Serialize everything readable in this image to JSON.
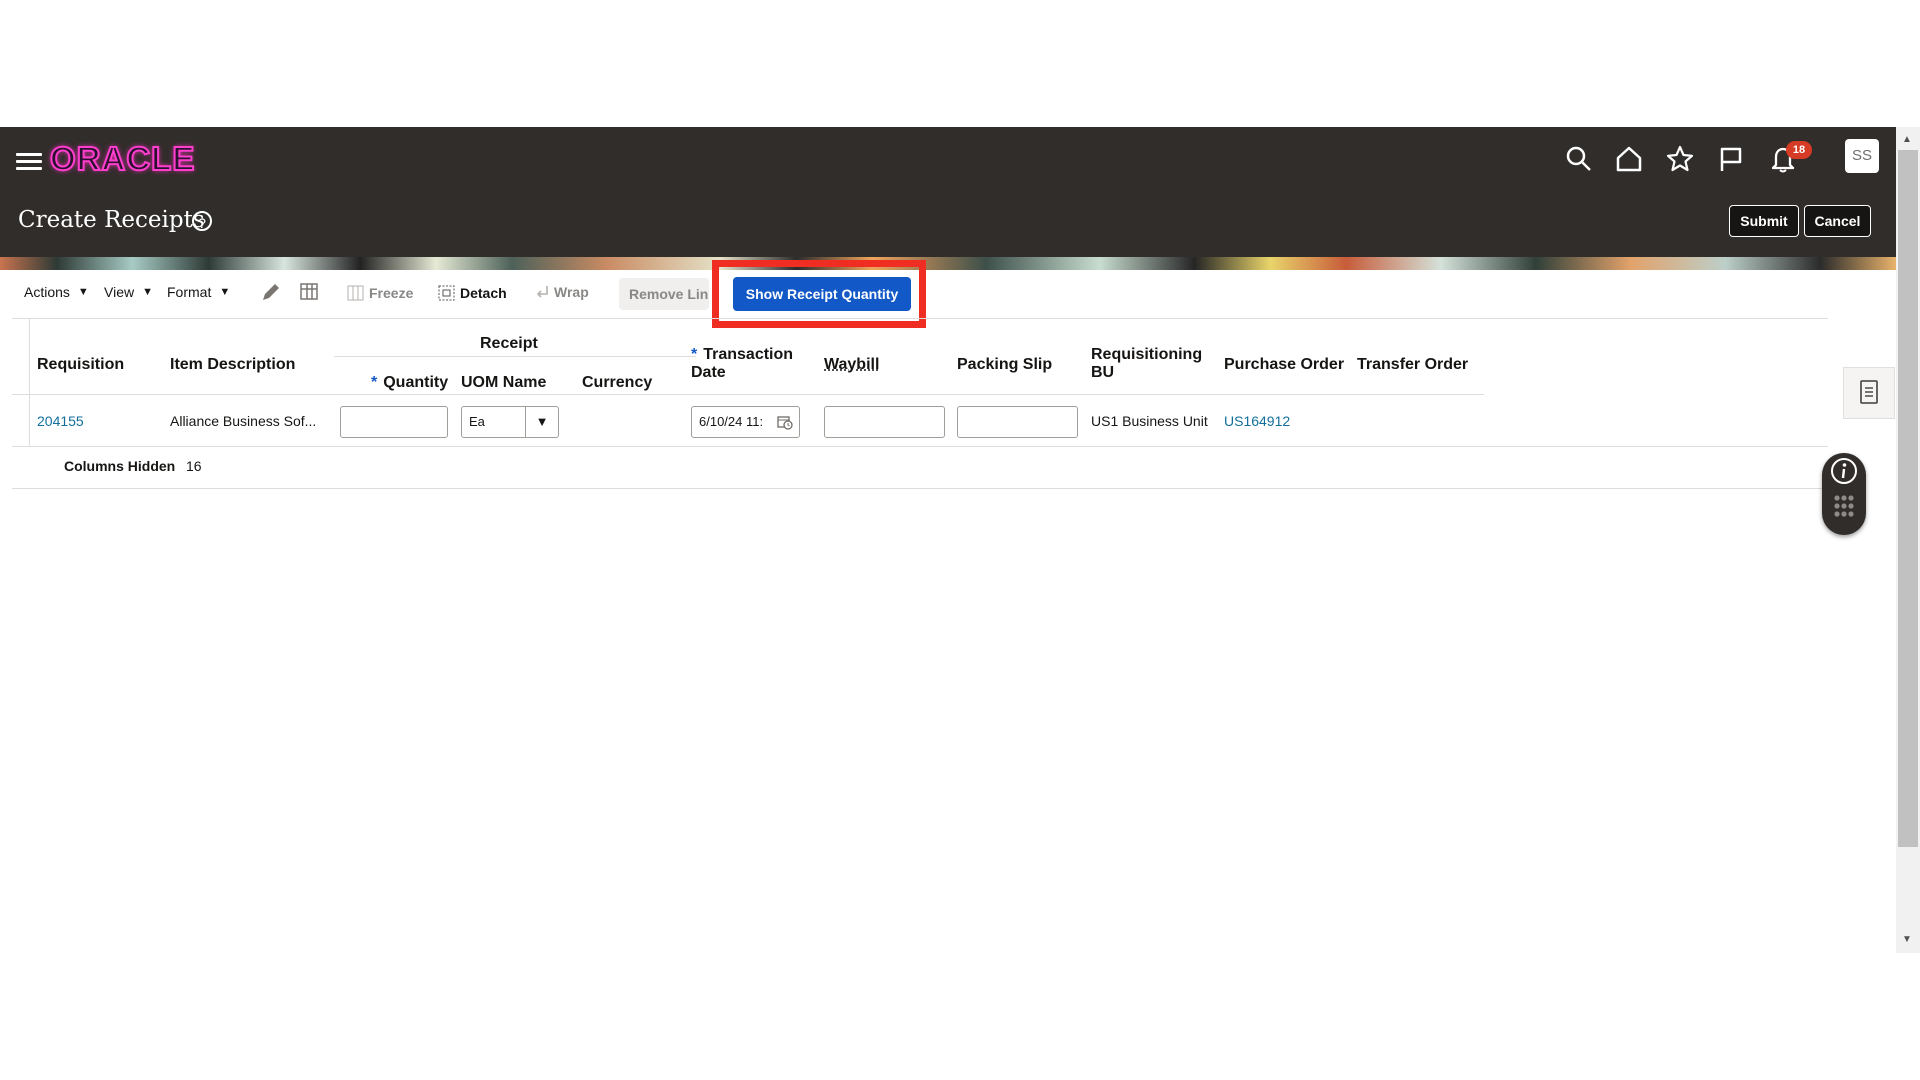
{
  "app": {
    "brand": "ORACLE",
    "page_title": "Create Receipts",
    "notification_count": "18",
    "user_initials": "SS",
    "submit_label": "Submit",
    "cancel_label": "Cancel",
    "icons": [
      "hamburger-menu-icon",
      "search-icon",
      "home-icon",
      "star-icon",
      "flag-icon",
      "bell-icon",
      "help-icon"
    ]
  },
  "toolbar": {
    "actions": "Actions",
    "view": "View",
    "format": "Format",
    "freeze": "Freeze",
    "detach": "Detach",
    "wrap": "Wrap",
    "remove_line": "Remove Lin",
    "show_receipt_quantity": "Show Receipt Quantity"
  },
  "table": {
    "group_header": "Receipt",
    "headers": {
      "requisition": "Requisition",
      "item_description": "Item Description",
      "quantity": "Quantity",
      "uom_name": "UOM Name",
      "currency": "Currency",
      "transaction_date_1": "Transaction",
      "transaction_date_2": "Date",
      "waybill": "Waybill",
      "packing_slip": "Packing Slip",
      "requisitioning_bu_1": "Requisitioning",
      "requisitioning_bu_2": "BU",
      "purchase_order": "Purchase Order",
      "transfer_order": "Transfer Order"
    },
    "row": {
      "requisition": "204155",
      "item_description": "Alliance Business Sof...",
      "quantity": "",
      "uom_name": "Ea",
      "currency": "",
      "transaction_date": "6/10/24 11:",
      "waybill": "",
      "packing_slip": "",
      "requisitioning_bu": "US1 Business Unit",
      "purchase_order": "US164912",
      "transfer_order": ""
    },
    "columns_hidden_label": "Columns Hidden",
    "columns_hidden_count": "16"
  },
  "colors": {
    "header_bg": "#312d2a",
    "primary_button": "#1258c7",
    "link": "#126f9c",
    "highlight": "#ef2d23",
    "badge": "#d63b25"
  }
}
